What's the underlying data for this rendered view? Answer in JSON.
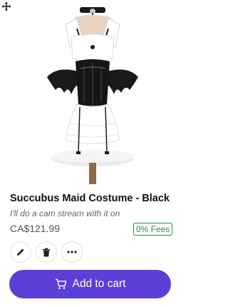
{
  "product": {
    "title": "Succubus Maid Costume - Black",
    "note": "I'll do a cam stream with it on",
    "price": "CA$121.99",
    "fees_badge": "0% Fees",
    "image_subject": "maid-costume-photo"
  },
  "actions": {
    "edit_icon": "pencil-icon",
    "delete_icon": "trash-icon",
    "more_icon": "more-icon",
    "add_to_cart_label": "Add to cart",
    "cart_icon": "cart-icon"
  },
  "colors": {
    "accent": "#5b3fd6",
    "fees_green": "#2e8b3f"
  }
}
